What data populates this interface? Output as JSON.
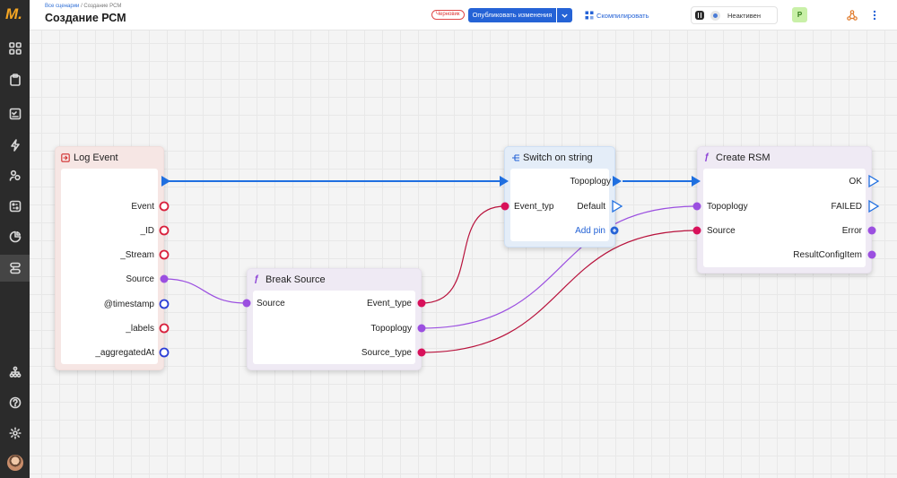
{
  "header": {
    "breadcrumb_root": "Все сценарии",
    "breadcrumb_sep": "/",
    "breadcrumb_current": "Создание РСМ",
    "title": "Создание РСМ",
    "draft_badge": "Черновик",
    "publish_label": "Опубликовать изменения",
    "compile_label": "Скомпилировать",
    "status_label": "Неактивен",
    "user_initial": "P"
  },
  "sidebar": {
    "logo_text": "M.",
    "items": [
      {
        "icon": "grid-icon"
      },
      {
        "icon": "clipboard-icon"
      },
      {
        "icon": "checklist-icon"
      },
      {
        "icon": "lightning-icon"
      },
      {
        "icon": "users-icon"
      },
      {
        "icon": "dashboard-icon"
      },
      {
        "icon": "pie-chart-icon"
      },
      {
        "icon": "scenarios-icon",
        "active": true
      },
      {
        "icon": "org-tree-icon"
      },
      {
        "icon": "help-icon"
      },
      {
        "icon": "settings-icon"
      }
    ]
  },
  "nodes": {
    "log_event": {
      "title": "Log Event",
      "outputs": [
        "Event",
        "_ID",
        "_Stream",
        "Source",
        "@timestamp",
        "_labels",
        "_aggregatedAt"
      ]
    },
    "break_source": {
      "title": "Break Source",
      "inputs": [
        "Source"
      ],
      "outputs": [
        "Event_type",
        "Topoplogy",
        "Source_type"
      ]
    },
    "switch_string": {
      "title": "Switch on string",
      "inputs": [
        "Event_typ"
      ],
      "outputs": [
        "Topoplogy",
        "Default"
      ],
      "add_pin": "Add pin"
    },
    "create_rsm": {
      "title": "Create RSM",
      "inputs": [
        "Topoplogy",
        "Source"
      ],
      "outputs": [
        "OK",
        "FAILED",
        "Error",
        "ResultConfigItem"
      ]
    }
  },
  "colors": {
    "exec": "#1f6fe0",
    "string_pin": "#d8105a",
    "struct_pin": "#9b4fe0",
    "open_pin_blue": "#2a3dd6",
    "open_pin_red": "#d8203c",
    "accent": "#2563d6"
  }
}
